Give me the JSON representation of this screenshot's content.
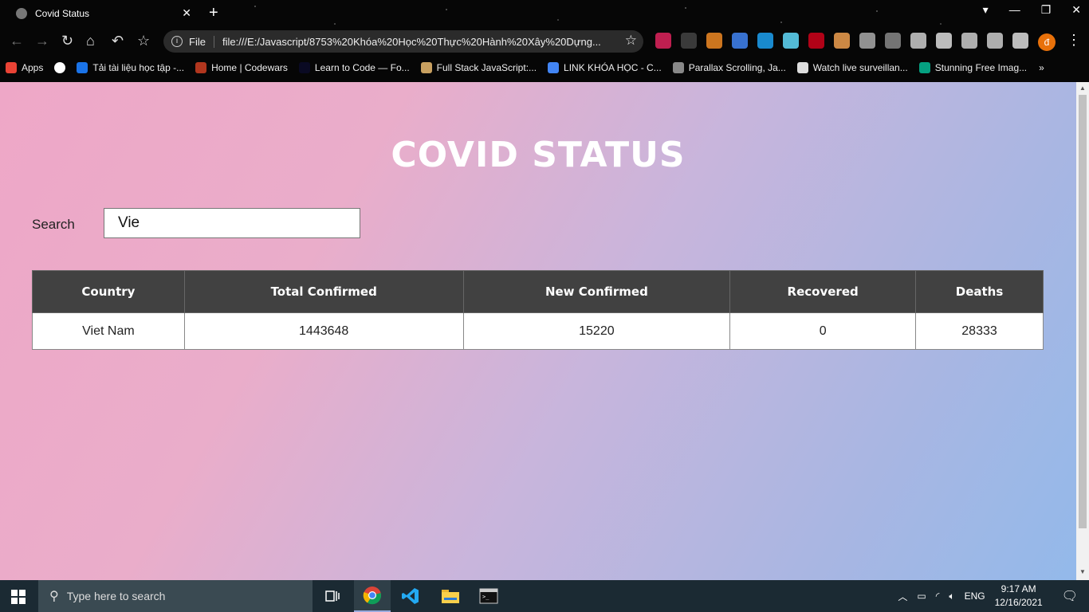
{
  "browser": {
    "tab_title": "Covid Status",
    "tab_close": "✕",
    "new_tab": "+",
    "scheme_label": "File",
    "url": "file:///E:/Javascript/8753%20Khóa%20Học%20Thực%20Hành%20Xây%20Dựng...",
    "profile_initial": "đ",
    "icons": [
      "back-icon",
      "forward-icon",
      "reload-icon",
      "home-icon",
      "undo-icon",
      "star-icon",
      "info-icon"
    ]
  },
  "bookmarks": [
    {
      "label": "Apps",
      "color": "#ea4335"
    },
    {
      "label": "",
      "color": "#ffffff"
    },
    {
      "label": "Tải tài liệu học tập -...",
      "color": "#1a73e8"
    },
    {
      "label": "Home | Codewars",
      "color": "#b1361e"
    },
    {
      "label": "Learn to Code — Fo...",
      "color": "#0a0a23"
    },
    {
      "label": "Full Stack JavaScript:...",
      "color": "#c8a060"
    },
    {
      "label": "LINK KHÓA HỌC - C...",
      "color": "#4285f4"
    },
    {
      "label": "Parallax Scrolling, Ja...",
      "color": "#888888"
    },
    {
      "label": "Watch live surveillan...",
      "color": "#dddddd"
    },
    {
      "label": "Stunning Free Imag...",
      "color": "#05a081"
    }
  ],
  "bookmarks_more": "»",
  "extensions": [
    {
      "name": "adblock-icon",
      "color": "#e0245e"
    },
    {
      "name": "messenger-icon",
      "color": "#444444"
    },
    {
      "name": "honey-icon",
      "color": "#f08a24"
    },
    {
      "name": "google-translate-icon",
      "color": "#4285f4"
    },
    {
      "name": "water-drop-icon",
      "color": "#1da1f2"
    },
    {
      "name": "react-icon",
      "color": "#61dafb"
    },
    {
      "name": "pinterest-icon",
      "color": "#d0021b"
    },
    {
      "name": "ruler-icon",
      "color": "#f0a050"
    },
    {
      "name": "target-icon",
      "color": "#aaaaaa"
    },
    {
      "name": "screenshot-icon",
      "color": "#888888"
    },
    {
      "name": "tools-icon",
      "color": "#cccccc"
    },
    {
      "name": "grid-icon",
      "color": "#dddddd"
    },
    {
      "name": "playlist-icon",
      "color": "#cccccc"
    },
    {
      "name": "crop-icon",
      "color": "#cccccc"
    },
    {
      "name": "download-icon",
      "color": "#dddddd"
    }
  ],
  "page": {
    "title": "COVID STATUS",
    "search_label": "Search",
    "search_value": "Vie",
    "table": {
      "headers": [
        "Country",
        "Total Confirmed",
        "New Confirmed",
        "Recovered",
        "Deaths"
      ],
      "rows": [
        [
          "Viet Nam",
          "1443648",
          "15220",
          "0",
          "28333"
        ]
      ]
    }
  },
  "taskbar": {
    "search_placeholder": "Type here to search",
    "language": "ENG",
    "time": "9:17 AM",
    "date": "12/16/2021"
  },
  "colors": {
    "table_header": "#414141",
    "title": "#ffffff"
  }
}
